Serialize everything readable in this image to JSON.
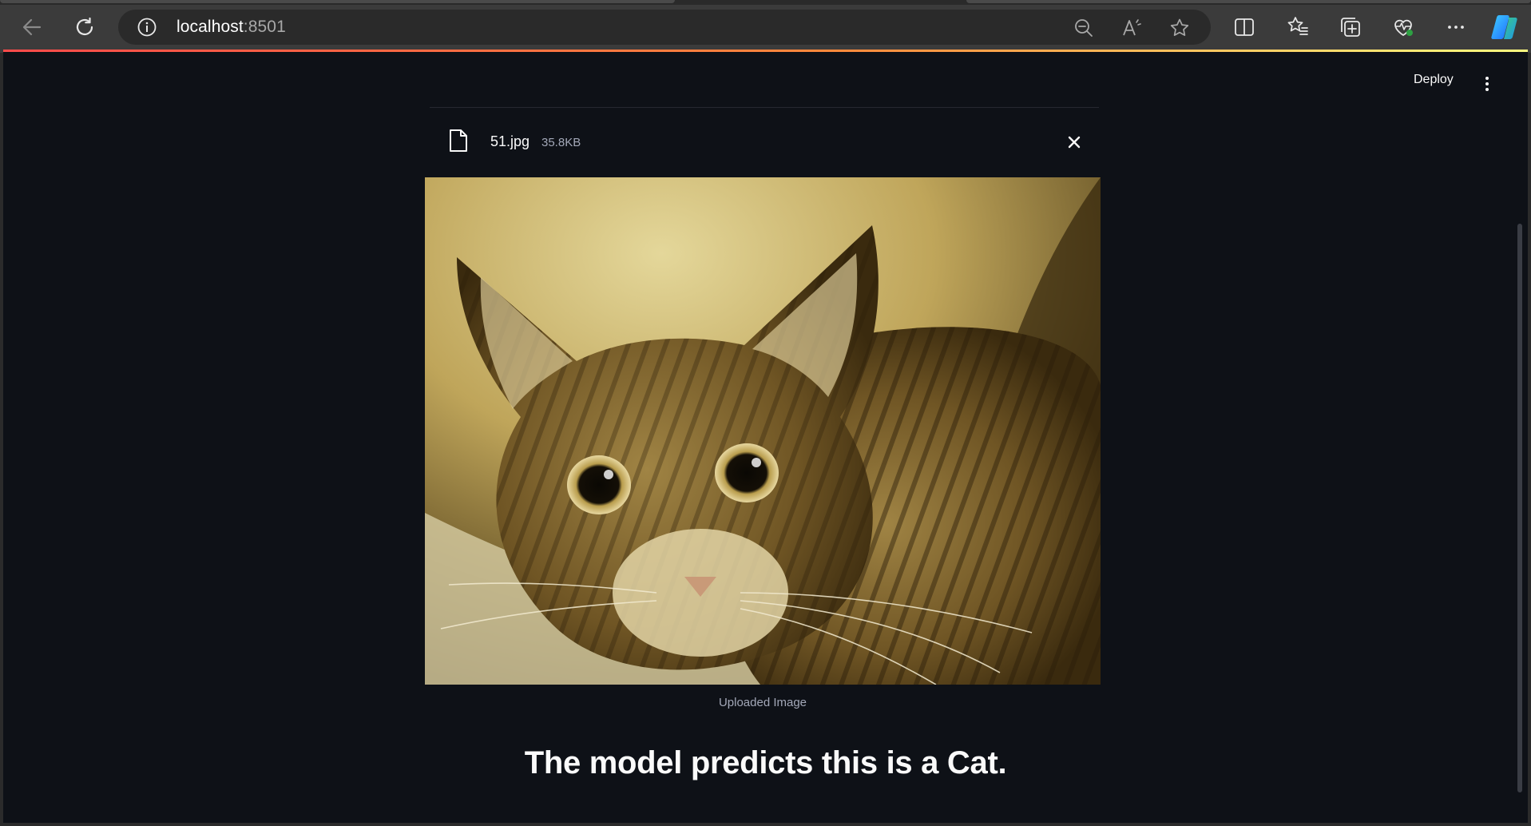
{
  "browser": {
    "url_host": "localhost",
    "url_port": ":8501"
  },
  "app": {
    "deploy_label": "Deploy",
    "file": {
      "name": "51.jpg",
      "size": "35.8KB"
    },
    "image_caption": "Uploaded Image",
    "prediction_text": "The model predicts this is a Cat."
  },
  "icons": {
    "back": "arrow-left-icon",
    "refresh": "refresh-icon",
    "site_info": "info-icon",
    "zoom": "zoom-out-icon",
    "read_aloud": "read-aloud-icon",
    "favorite": "star-icon",
    "split": "split-screen-icon",
    "favorites": "favorites-list-icon",
    "collections": "collections-icon",
    "health": "browser-essentials-icon",
    "more": "more-dots-icon",
    "copilot": "copilot-icon",
    "file": "file-icon",
    "close": "close-icon",
    "menu": "kebab-menu-icon"
  },
  "colors": {
    "app_bg": "#0e1117",
    "text": "#fafafa",
    "muted": "#a3a8b8",
    "accent_gradient_start": "#ff4b4b",
    "accent_gradient_end": "#fffd80"
  }
}
